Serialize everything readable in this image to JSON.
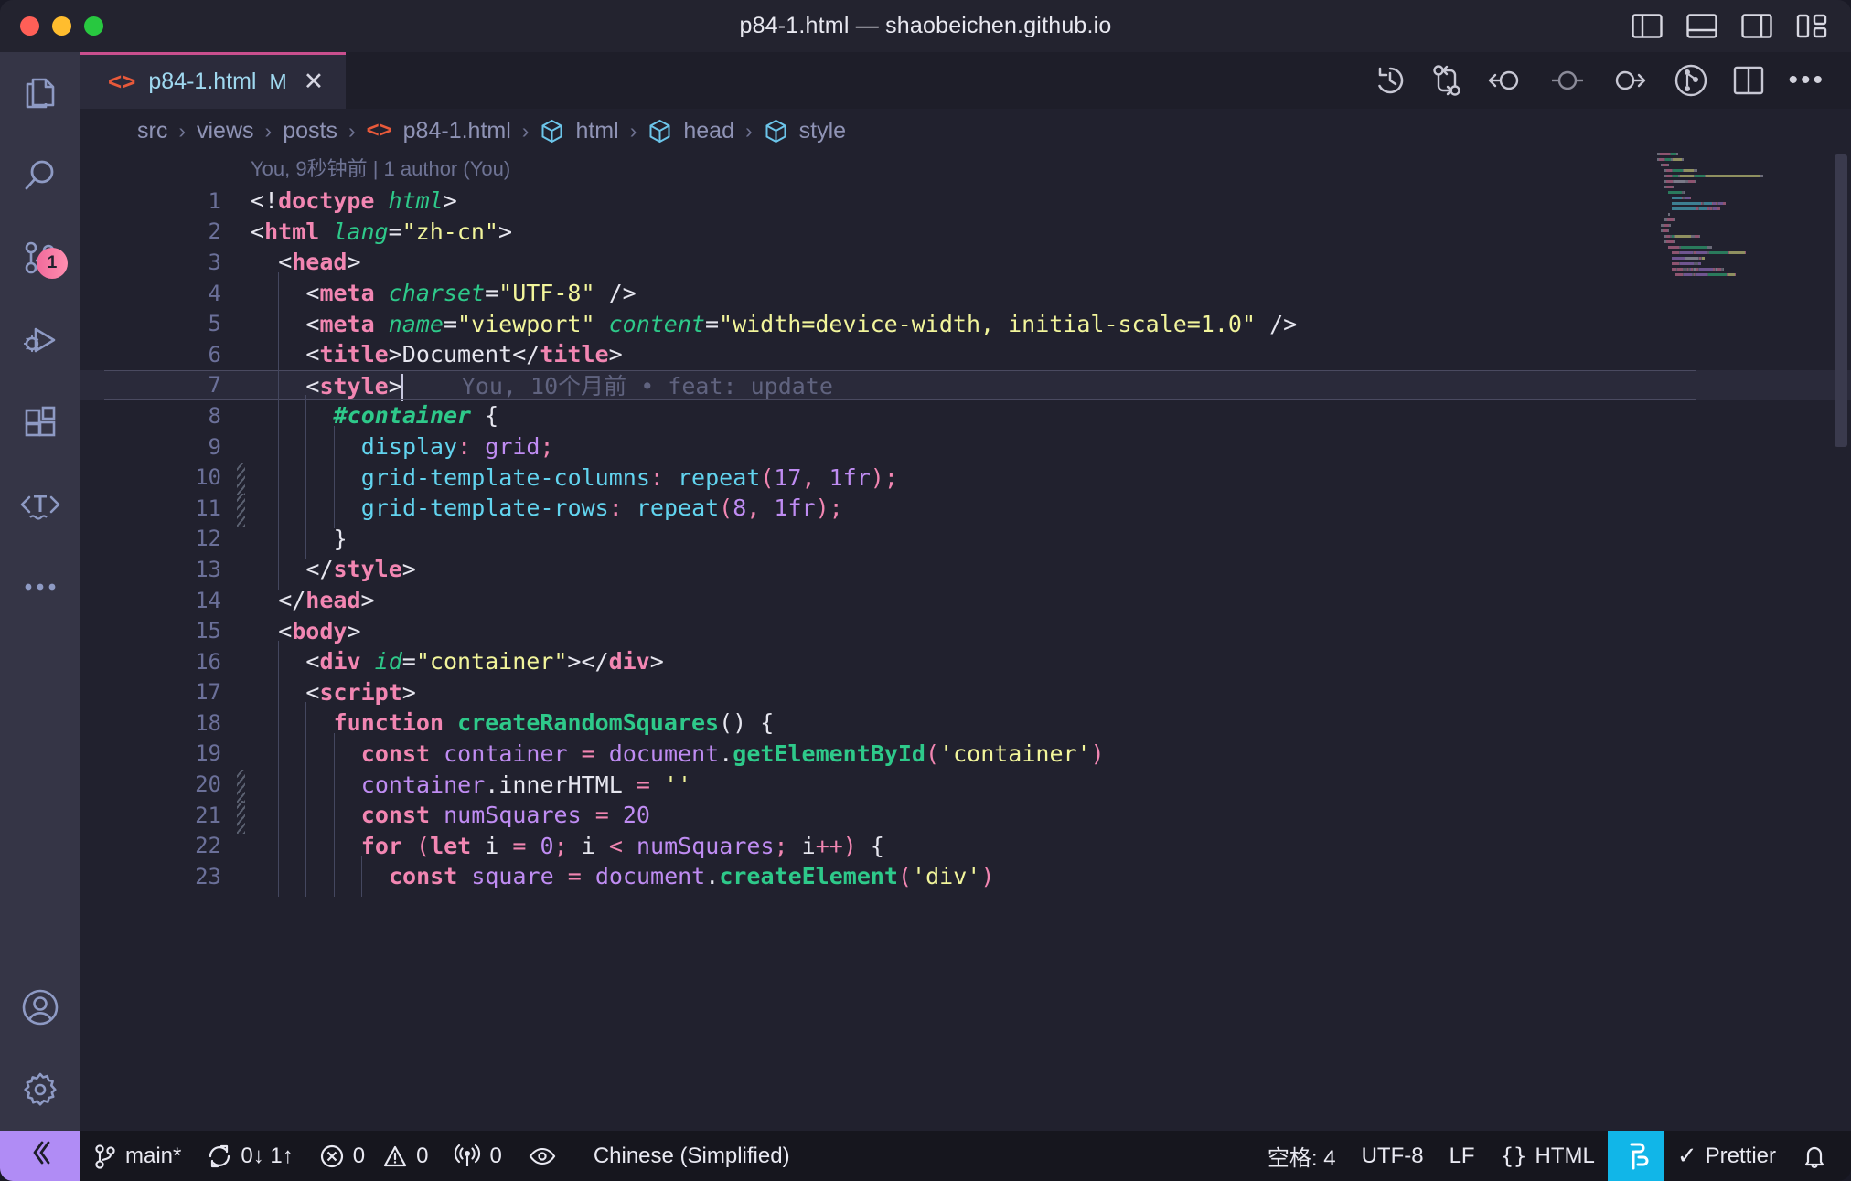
{
  "window": {
    "title": "p84-1.html — shaobeichen.github.io",
    "traffic_lights": [
      "close-red",
      "minimize-yellow",
      "maximize-green"
    ],
    "layout_toggles": [
      {
        "name": "toggle-primary-sidebar",
        "label": "Toggle Primary Side Bar"
      },
      {
        "name": "toggle-panel",
        "label": "Toggle Panel"
      },
      {
        "name": "toggle-secondary-sidebar",
        "label": "Toggle Secondary Side Bar"
      },
      {
        "name": "customize-layout",
        "label": "Customize Layout"
      }
    ]
  },
  "activitybar": {
    "items": [
      {
        "name": "explorer",
        "icon": "files-icon",
        "badge": null
      },
      {
        "name": "search",
        "icon": "search-icon",
        "badge": null
      },
      {
        "name": "source-control",
        "icon": "source-control-icon",
        "badge": "1"
      },
      {
        "name": "run-and-debug",
        "icon": "debug-icon",
        "badge": null
      },
      {
        "name": "extensions",
        "icon": "extensions-icon",
        "badge": null
      },
      {
        "name": "spell-checker",
        "icon": "spell-check-icon",
        "badge": null
      },
      {
        "name": "additional-views",
        "icon": "ellipsis-icon",
        "badge": null
      }
    ],
    "bottom": [
      {
        "name": "accounts",
        "icon": "account-icon"
      },
      {
        "name": "manage",
        "icon": "gear-icon"
      }
    ]
  },
  "tab": {
    "filename": "p84-1.html",
    "dirty_badge": "M",
    "close": "✕",
    "file_icon": "html5-icon"
  },
  "editor_actions": [
    {
      "name": "timeline-history-icon",
      "label": "Timeline"
    },
    {
      "name": "compare-changes-icon",
      "label": "Open Changes"
    },
    {
      "name": "previous-change-icon",
      "label": "Previous Change"
    },
    {
      "name": "current-change-icon",
      "label": "Current Change"
    },
    {
      "name": "next-change-icon",
      "label": "Next Change"
    },
    {
      "name": "git-graph-icon",
      "label": "Git Graph"
    },
    {
      "name": "split-editor-icon",
      "label": "Split Editor"
    },
    {
      "name": "more-actions-icon",
      "label": "More Actions..."
    }
  ],
  "breadcrumb": {
    "separator": "›",
    "items": [
      {
        "label": "src",
        "icon": null
      },
      {
        "label": "views",
        "icon": null
      },
      {
        "label": "posts",
        "icon": null
      },
      {
        "label": "p84-1.html",
        "icon": "html5-icon"
      },
      {
        "label": "html",
        "icon": "symbol-cube-icon"
      },
      {
        "label": "head",
        "icon": "symbol-cube-icon"
      },
      {
        "label": "style",
        "icon": "symbol-cube-icon"
      }
    ]
  },
  "blame": {
    "header": "You, 9秒钟前 | 1 author (You)",
    "inline": "You, 10个月前 • feat: update"
  },
  "code": {
    "current_line": 7,
    "changed_lines": [
      10,
      11,
      20,
      21
    ],
    "lines": [
      {
        "n": 1,
        "indent": 0,
        "tokens": [
          {
            "t": "punc",
            "v": "<!"
          },
          {
            "t": "tag",
            "v": "doctype"
          },
          {
            "t": "plain",
            "v": " "
          },
          {
            "t": "attr",
            "v": "html"
          },
          {
            "t": "punc",
            "v": ">"
          }
        ]
      },
      {
        "n": 2,
        "indent": 0,
        "tokens": [
          {
            "t": "punc",
            "v": "<"
          },
          {
            "t": "tag",
            "v": "html"
          },
          {
            "t": "plain",
            "v": " "
          },
          {
            "t": "attr",
            "v": "lang"
          },
          {
            "t": "punc",
            "v": "="
          },
          {
            "t": "str",
            "v": "\"zh-cn\""
          },
          {
            "t": "punc",
            "v": ">"
          }
        ]
      },
      {
        "n": 3,
        "indent": 1,
        "tokens": [
          {
            "t": "punc",
            "v": "<"
          },
          {
            "t": "tag",
            "v": "head"
          },
          {
            "t": "punc",
            "v": ">"
          }
        ]
      },
      {
        "n": 4,
        "indent": 2,
        "tokens": [
          {
            "t": "punc",
            "v": "<"
          },
          {
            "t": "tag",
            "v": "meta"
          },
          {
            "t": "plain",
            "v": " "
          },
          {
            "t": "attr",
            "v": "charset"
          },
          {
            "t": "punc",
            "v": "="
          },
          {
            "t": "str",
            "v": "\"UTF-8\""
          },
          {
            "t": "punc",
            "v": " />"
          }
        ]
      },
      {
        "n": 5,
        "indent": 2,
        "tokens": [
          {
            "t": "punc",
            "v": "<"
          },
          {
            "t": "tag",
            "v": "meta"
          },
          {
            "t": "plain",
            "v": " "
          },
          {
            "t": "attr",
            "v": "name"
          },
          {
            "t": "punc",
            "v": "="
          },
          {
            "t": "str",
            "v": "\"viewport\""
          },
          {
            "t": "plain",
            "v": " "
          },
          {
            "t": "attr",
            "v": "content"
          },
          {
            "t": "punc",
            "v": "="
          },
          {
            "t": "str",
            "v": "\"width=device-width, initial-scale=1.0\""
          },
          {
            "t": "punc",
            "v": " />"
          }
        ]
      },
      {
        "n": 6,
        "indent": 2,
        "tokens": [
          {
            "t": "punc",
            "v": "<"
          },
          {
            "t": "tag",
            "v": "title"
          },
          {
            "t": "punc",
            "v": ">"
          },
          {
            "t": "text",
            "v": "Document"
          },
          {
            "t": "punc",
            "v": "</"
          },
          {
            "t": "tag",
            "v": "title"
          },
          {
            "t": "punc",
            "v": ">"
          }
        ]
      },
      {
        "n": 7,
        "indent": 2,
        "tokens": [
          {
            "t": "punc",
            "v": "<"
          },
          {
            "t": "tag",
            "v": "style"
          },
          {
            "t": "punc",
            "v": ">"
          },
          {
            "t": "cursor",
            "v": ""
          },
          {
            "t": "blame",
            "v": "You, 10个月前 • feat: update"
          }
        ]
      },
      {
        "n": 8,
        "indent": 3,
        "tokens": [
          {
            "t": "sel",
            "v": "#container"
          },
          {
            "t": "plain",
            "v": " "
          },
          {
            "t": "punc",
            "v": "{"
          }
        ]
      },
      {
        "n": 9,
        "indent": 4,
        "tokens": [
          {
            "t": "prop",
            "v": "display"
          },
          {
            "t": "semi",
            "v": ":"
          },
          {
            "t": "plain",
            "v": " "
          },
          {
            "t": "val",
            "v": "grid"
          },
          {
            "t": "semi",
            "v": ";"
          }
        ]
      },
      {
        "n": 10,
        "indent": 4,
        "tokens": [
          {
            "t": "prop",
            "v": "grid-template-columns"
          },
          {
            "t": "semi",
            "v": ":"
          },
          {
            "t": "plain",
            "v": " "
          },
          {
            "t": "prop",
            "v": "repeat"
          },
          {
            "t": "semi",
            "v": "("
          },
          {
            "t": "num",
            "v": "17"
          },
          {
            "t": "semi",
            "v": ","
          },
          {
            "t": "plain",
            "v": " "
          },
          {
            "t": "num",
            "v": "1fr"
          },
          {
            "t": "semi",
            "v": ");"
          }
        ]
      },
      {
        "n": 11,
        "indent": 4,
        "tokens": [
          {
            "t": "prop",
            "v": "grid-template-rows"
          },
          {
            "t": "semi",
            "v": ":"
          },
          {
            "t": "plain",
            "v": " "
          },
          {
            "t": "prop",
            "v": "repeat"
          },
          {
            "t": "semi",
            "v": "("
          },
          {
            "t": "num",
            "v": "8"
          },
          {
            "t": "semi",
            "v": ","
          },
          {
            "t": "plain",
            "v": " "
          },
          {
            "t": "num",
            "v": "1fr"
          },
          {
            "t": "semi",
            "v": ");"
          }
        ]
      },
      {
        "n": 12,
        "indent": 3,
        "tokens": [
          {
            "t": "punc",
            "v": "}"
          }
        ]
      },
      {
        "n": 13,
        "indent": 2,
        "tokens": [
          {
            "t": "punc",
            "v": "</"
          },
          {
            "t": "tag",
            "v": "style"
          },
          {
            "t": "punc",
            "v": ">"
          }
        ]
      },
      {
        "n": 14,
        "indent": 1,
        "tokens": [
          {
            "t": "punc",
            "v": "</"
          },
          {
            "t": "tag",
            "v": "head"
          },
          {
            "t": "punc",
            "v": ">"
          }
        ]
      },
      {
        "n": 15,
        "indent": 1,
        "tokens": [
          {
            "t": "punc",
            "v": "<"
          },
          {
            "t": "tag",
            "v": "body"
          },
          {
            "t": "punc",
            "v": ">"
          }
        ]
      },
      {
        "n": 16,
        "indent": 2,
        "tokens": [
          {
            "t": "punc",
            "v": "<"
          },
          {
            "t": "tag",
            "v": "div"
          },
          {
            "t": "plain",
            "v": " "
          },
          {
            "t": "attr",
            "v": "id"
          },
          {
            "t": "punc",
            "v": "="
          },
          {
            "t": "str",
            "v": "\"container\""
          },
          {
            "t": "punc",
            "v": "></"
          },
          {
            "t": "tag",
            "v": "div"
          },
          {
            "t": "punc",
            "v": ">"
          }
        ]
      },
      {
        "n": 17,
        "indent": 2,
        "tokens": [
          {
            "t": "punc",
            "v": "<"
          },
          {
            "t": "tag",
            "v": "script"
          },
          {
            "t": "punc",
            "v": ">"
          }
        ]
      },
      {
        "n": 18,
        "indent": 3,
        "tokens": [
          {
            "t": "kw",
            "v": "function"
          },
          {
            "t": "plain",
            "v": " "
          },
          {
            "t": "fn",
            "v": "createRandomSquares"
          },
          {
            "t": "punc",
            "v": "() {"
          }
        ]
      },
      {
        "n": 19,
        "indent": 4,
        "tokens": [
          {
            "t": "kw",
            "v": "const"
          },
          {
            "t": "plain",
            "v": " "
          },
          {
            "t": "var",
            "v": "container"
          },
          {
            "t": "plain",
            "v": " "
          },
          {
            "t": "semi",
            "v": "="
          },
          {
            "t": "plain",
            "v": " "
          },
          {
            "t": "var",
            "v": "document"
          },
          {
            "t": "plain",
            "v": "."
          },
          {
            "t": "fn",
            "v": "getElementById"
          },
          {
            "t": "semi",
            "v": "("
          },
          {
            "t": "str",
            "v": "'container'"
          },
          {
            "t": "semi",
            "v": ")"
          }
        ]
      },
      {
        "n": 20,
        "indent": 4,
        "tokens": [
          {
            "t": "var",
            "v": "container"
          },
          {
            "t": "plain",
            "v": "."
          },
          {
            "t": "text",
            "v": "innerHTML"
          },
          {
            "t": "plain",
            "v": " "
          },
          {
            "t": "semi",
            "v": "="
          },
          {
            "t": "plain",
            "v": " "
          },
          {
            "t": "str",
            "v": "''"
          }
        ]
      },
      {
        "n": 21,
        "indent": 4,
        "tokens": [
          {
            "t": "kw",
            "v": "const"
          },
          {
            "t": "plain",
            "v": " "
          },
          {
            "t": "var",
            "v": "numSquares"
          },
          {
            "t": "plain",
            "v": " "
          },
          {
            "t": "semi",
            "v": "="
          },
          {
            "t": "plain",
            "v": " "
          },
          {
            "t": "num",
            "v": "20"
          }
        ]
      },
      {
        "n": 22,
        "indent": 4,
        "tokens": [
          {
            "t": "kw",
            "v": "for"
          },
          {
            "t": "plain",
            "v": " "
          },
          {
            "t": "semi",
            "v": "("
          },
          {
            "t": "kw",
            "v": "let"
          },
          {
            "t": "plain",
            "v": " "
          },
          {
            "t": "text",
            "v": "i"
          },
          {
            "t": "plain",
            "v": " "
          },
          {
            "t": "semi",
            "v": "="
          },
          {
            "t": "plain",
            "v": " "
          },
          {
            "t": "num",
            "v": "0"
          },
          {
            "t": "semi",
            "v": ";"
          },
          {
            "t": "plain",
            "v": " "
          },
          {
            "t": "text",
            "v": "i"
          },
          {
            "t": "plain",
            "v": " "
          },
          {
            "t": "semi",
            "v": "<"
          },
          {
            "t": "plain",
            "v": " "
          },
          {
            "t": "var",
            "v": "numSquares"
          },
          {
            "t": "semi",
            "v": ";"
          },
          {
            "t": "plain",
            "v": " "
          },
          {
            "t": "text",
            "v": "i"
          },
          {
            "t": "semi",
            "v": "++)"
          },
          {
            "t": "plain",
            "v": " "
          },
          {
            "t": "punc",
            "v": "{"
          }
        ]
      },
      {
        "n": 23,
        "indent": 5,
        "tokens": [
          {
            "t": "kw",
            "v": "const"
          },
          {
            "t": "plain",
            "v": " "
          },
          {
            "t": "var",
            "v": "square"
          },
          {
            "t": "plain",
            "v": " "
          },
          {
            "t": "semi",
            "v": "="
          },
          {
            "t": "plain",
            "v": " "
          },
          {
            "t": "var",
            "v": "document"
          },
          {
            "t": "plain",
            "v": "."
          },
          {
            "t": "fn",
            "v": "createElement"
          },
          {
            "t": "semi",
            "v": "("
          },
          {
            "t": "str",
            "v": "'div'"
          },
          {
            "t": "semi",
            "v": ")"
          }
        ]
      }
    ]
  },
  "statusbar": {
    "remote_icon": "remote-window-icon",
    "left": [
      {
        "name": "branch",
        "icon": "git-branch-icon",
        "label": "main*"
      },
      {
        "name": "sync",
        "icon": "sync-icon",
        "label": "0↓ 1↑"
      },
      {
        "name": "errors",
        "icon": "error-icon",
        "label": "0"
      },
      {
        "name": "warnings",
        "icon": "warning-icon",
        "label": "0"
      },
      {
        "name": "ports",
        "icon": "radio-tower-icon",
        "label": "0"
      },
      {
        "name": "watch",
        "icon": "eye-icon",
        "label": ""
      },
      {
        "name": "language-locale",
        "icon": null,
        "label": "Chinese (Simplified)"
      }
    ],
    "right": [
      {
        "name": "indentation",
        "icon": null,
        "label": "空格: 4"
      },
      {
        "name": "encoding",
        "icon": null,
        "label": "UTF-8"
      },
      {
        "name": "eol",
        "icon": null,
        "label": "LF"
      },
      {
        "name": "language-mode",
        "icon": "braces-icon",
        "label": "HTML"
      },
      {
        "name": "formatter-status",
        "icon": "prettier-brand-icon",
        "label": ""
      },
      {
        "name": "prettier",
        "icon": "check-icon",
        "label": "Prettier"
      },
      {
        "name": "notifications",
        "icon": "bell-icon",
        "label": ""
      }
    ]
  },
  "colors": {
    "accent_tab_border": "#c94f8e",
    "remote_bg": "#b08cf5",
    "badge_bg": "#f06a9b",
    "formatter_bg": "#11b6e8",
    "editor_bg": "#21212e",
    "activitybar_bg": "#353546"
  }
}
